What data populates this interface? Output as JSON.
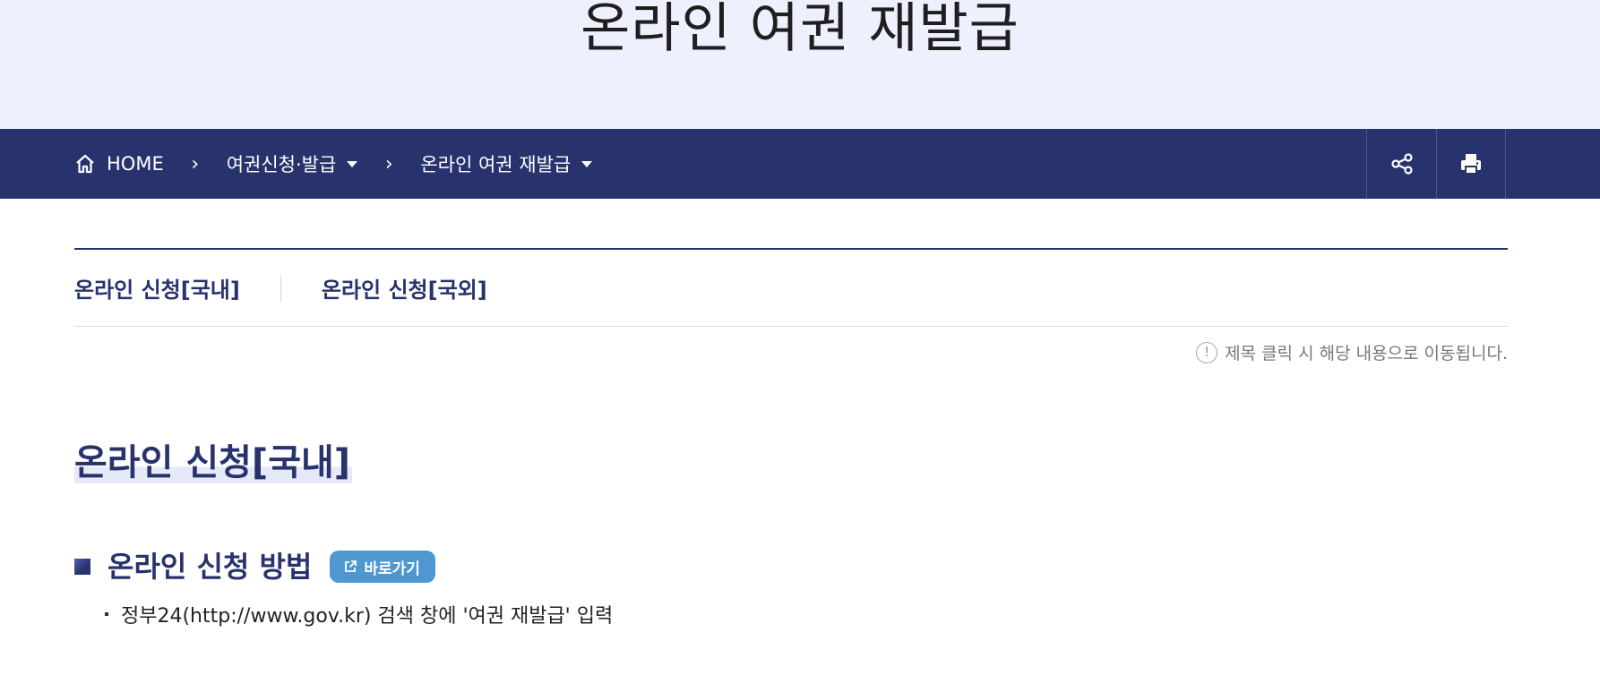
{
  "hero": {
    "title": "온라인 여권 재발급"
  },
  "breadcrumb": {
    "home": "HOME",
    "level1": "여권신청·발급",
    "level2": "온라인 여권 재발급"
  },
  "toolbar": {
    "share_icon": "share-icon",
    "print_icon": "print-icon"
  },
  "tabs": [
    {
      "label": "온라인 신청[국내]"
    },
    {
      "label": "온라인 신청[국외]"
    }
  ],
  "hint": {
    "text": "제목 클릭 시 해당 내용으로 이동됩니다."
  },
  "section": {
    "title": "온라인 신청[국내]",
    "subsection": {
      "title": "온라인 신청 방법",
      "button_label": "바로가기",
      "items": [
        "정부24(http://www.gov.kr) 검색 창에 '여권 재발급' 입력"
      ]
    }
  },
  "colors": {
    "navy": "#28336e",
    "hero_bg": "#eef0fd",
    "button_blue": "#4f97d0"
  }
}
